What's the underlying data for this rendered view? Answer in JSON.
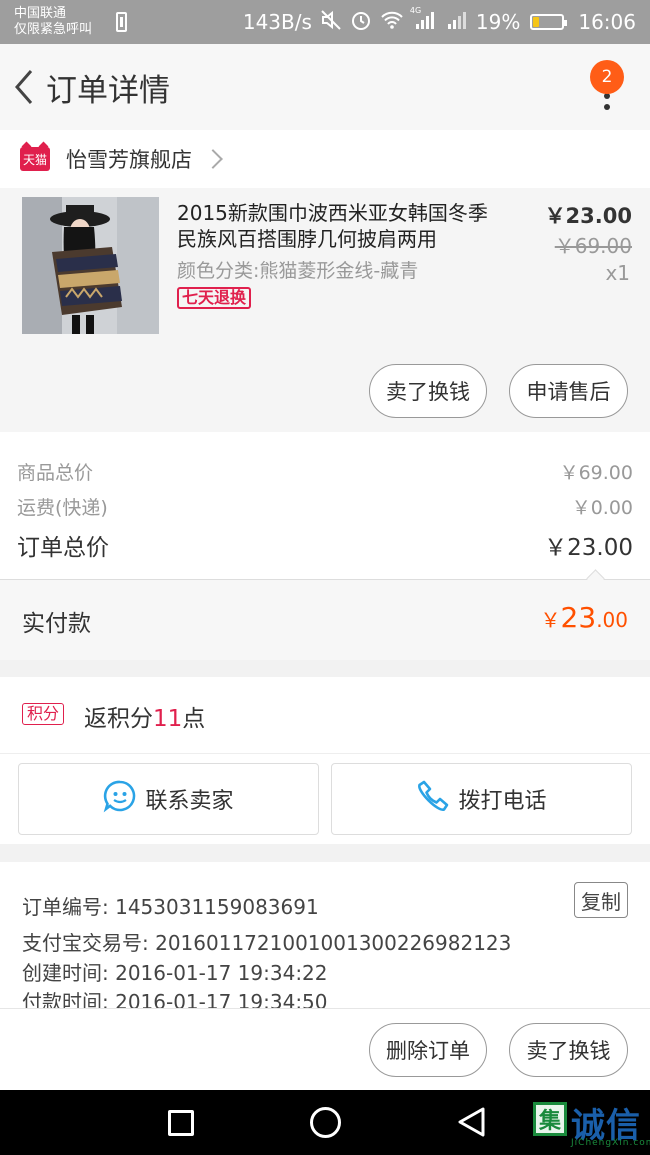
{
  "status_bar": {
    "carrier_line1": "中国联通",
    "carrier_line2": "仅限紧急呼叫",
    "speed": "143B/s",
    "network": "4G",
    "battery": "19%",
    "battery_level": 0.19,
    "time": "16:06"
  },
  "header": {
    "title": "订单详情",
    "badge_count": "2"
  },
  "shop": {
    "logo_text": "天猫",
    "name": "怡雪芳旗舰店"
  },
  "product": {
    "title": "2015新款围巾波西米亚女韩国冬季民族风百搭围脖几何披肩两用",
    "spec": "颜色分类:熊猫菱形金线-藏青",
    "return_badge": "七天退换",
    "price_now": "￥23.00",
    "price_old": "￥69.00",
    "quantity": "x1",
    "btn_resell": "卖了换钱",
    "btn_aftersale": "申请售后"
  },
  "summary": {
    "goods_label": "商品总价",
    "goods_value": "￥69.00",
    "shipping_label": "运费(快递)",
    "shipping_value": "￥0.00",
    "total_label": "订单总价",
    "total_value": "￥23.00"
  },
  "paid": {
    "label": "实付款",
    "currency": "￥",
    "integer": "23",
    "decimal": ".00"
  },
  "points": {
    "badge": "积分",
    "prefix": "返积分",
    "count": "11",
    "suffix": "点"
  },
  "contact": {
    "seller_label": "联系卖家",
    "call_label": "拨打电话"
  },
  "order_info": {
    "order_no": "订单编号: 1453031159083691",
    "alipay_no": "支付宝交易号: 2016011721001001300226982123",
    "created": "创建时间: 2016-01-17 19:34:22",
    "paid_at": "付款时间: 2016-01-17 19:34:50",
    "copy_label": "复制"
  },
  "actions": {
    "delete_label": "删除订单",
    "resell_label": "卖了换钱"
  },
  "watermark": {
    "logo_char": "集",
    "text": "诚信",
    "sub": "JiChengXin.com"
  },
  "colors": {
    "accent_orange": "#ff5000",
    "tmall_red": "#e0204d",
    "badge_orange": "#ff5d17",
    "icon_blue": "#2aa3e6"
  }
}
